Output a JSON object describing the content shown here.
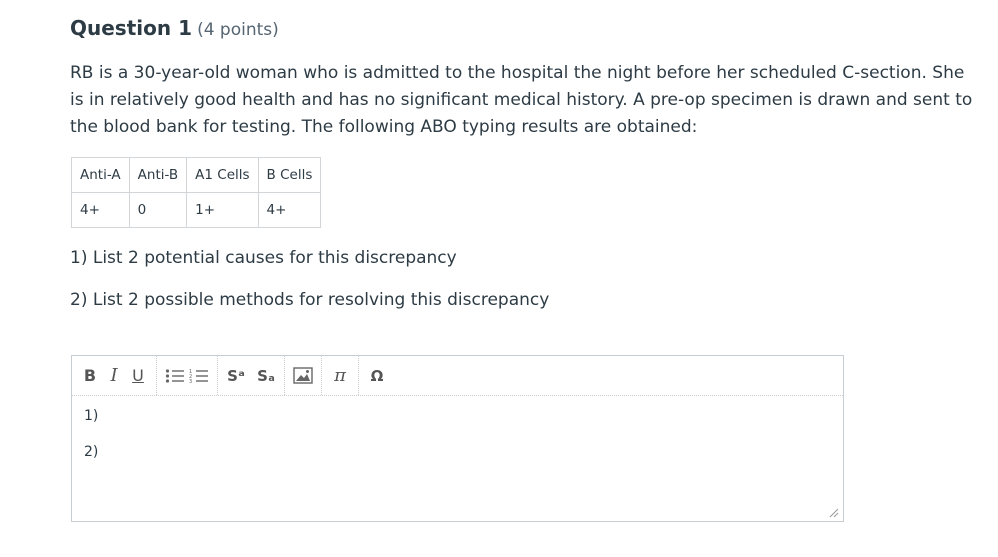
{
  "question": {
    "title": "Question 1",
    "points": "(4 points)",
    "text": "RB is a 30-year-old woman who is admitted to the hospital the night before her scheduled C-section. She is in relatively good health and has no significant medical history. A pre-op specimen is drawn and sent to the blood bank for testing. The following ABO typing results are obtained:"
  },
  "abo_table": {
    "headers": [
      "Anti-A",
      "Anti-B",
      "A1 Cells",
      "B Cells"
    ],
    "row": [
      "4+",
      "0",
      "1+",
      "4+"
    ]
  },
  "prompts": {
    "p1": "1) List 2 potential causes for this discrepancy",
    "p2": "2) List 2 possible methods for resolving this discrepancy"
  },
  "editor": {
    "toolbar": {
      "bold": "B",
      "italic": "I",
      "underline": "U",
      "superscript": "Sᵃ",
      "subscript": "Sₐ",
      "pi": "π",
      "omega": "Ω"
    },
    "lines": [
      "1)",
      "2)"
    ]
  }
}
